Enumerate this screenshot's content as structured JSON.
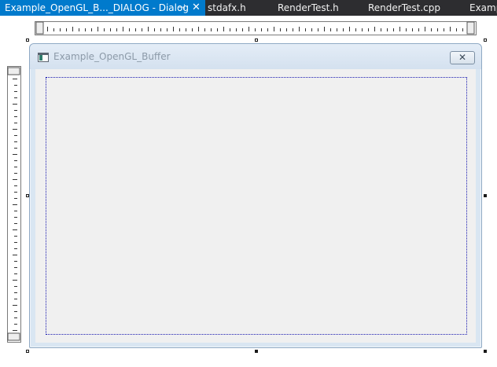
{
  "tabs": [
    {
      "label": "Example_OpenGL_B..._DIALOG - Dialog",
      "active": true
    },
    {
      "label": "stdafx.h",
      "active": false
    },
    {
      "label": "RenderTest.h",
      "active": false
    },
    {
      "label": "RenderTest.cpp",
      "active": false
    },
    {
      "label": "Examp",
      "active": false
    }
  ],
  "tab_icons": {
    "pin": "pin-icon",
    "close": "close-icon"
  },
  "dialog": {
    "title": "Example_OpenGL_Buffer",
    "icon": "dialog-window-icon",
    "close_icon": "close-icon"
  },
  "colors": {
    "tabbar_bg": "#2d2d30",
    "active_tab_bg": "#007acc",
    "tab_text": "#f1f1f1",
    "dialog_frame": "#d9e6f2",
    "dialog_client": "#f0f0f0",
    "focus_rect": "#1a1ab0"
  }
}
